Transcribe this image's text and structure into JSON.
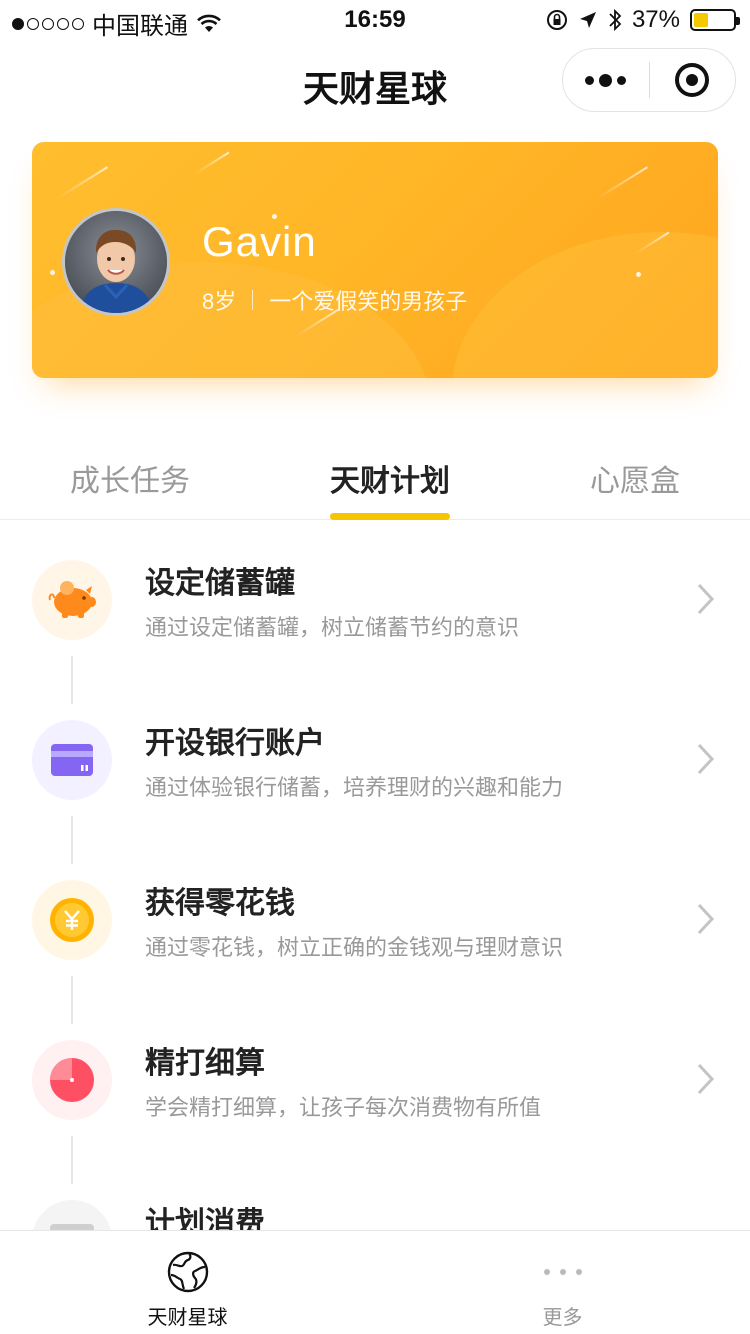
{
  "status_bar": {
    "carrier": "中国联通",
    "time": "16:59",
    "battery": "37%",
    "battery_level": 0.37
  },
  "nav": {
    "title": "天财星球",
    "more_icon": "more-dots-icon",
    "close_icon": "target-close-icon"
  },
  "profile": {
    "name": "Gavin",
    "age": "8岁",
    "bio": "一个爱假笑的男孩子"
  },
  "tabs": [
    {
      "label": "成长任务",
      "active": false
    },
    {
      "label": "天财计划",
      "active": true
    },
    {
      "label": "心愿盒",
      "active": false
    }
  ],
  "plans": [
    {
      "title": "设定储蓄罐",
      "desc": "通过设定储蓄罐，树立储蓄节约的意识",
      "icon": "piggy-bank-icon",
      "accent": "#ff8a1c",
      "bg": "#fff6e8"
    },
    {
      "title": "开设银行账户",
      "desc": "通过体验银行储蓄，培养理财的兴趣和能力",
      "icon": "bank-card-icon",
      "accent": "#8466f2",
      "bg": "#f3f1ff"
    },
    {
      "title": "获得零花钱",
      "desc": "通过零花钱，树立正确的金钱观与理财意识",
      "icon": "yuan-coin-icon",
      "accent": "#ffb300",
      "bg": "#fff7e3"
    },
    {
      "title": "精打细算",
      "desc": "学会精打细算，让孩子每次消费物有所值",
      "icon": "pie-chart-icon",
      "accent": "#ff4f63",
      "bg": "#fff0f1"
    },
    {
      "title": "计划消费",
      "desc": "",
      "icon": "plan-card-icon",
      "accent": "#cfcfcf",
      "bg": "#f4f4f4"
    }
  ],
  "tabbar": [
    {
      "label": "天财星球",
      "icon": "planet-globe-icon",
      "active": true
    },
    {
      "label": "更多",
      "icon": "more-dots-icon",
      "active": false
    }
  ],
  "colors": {
    "brand_yellow": "#f7c400",
    "card_orange": "#ffb627"
  }
}
